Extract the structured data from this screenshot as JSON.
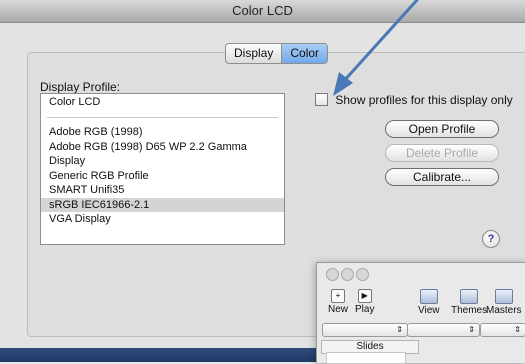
{
  "window": {
    "title": "Color LCD"
  },
  "tabs": [
    {
      "label": "Display"
    },
    {
      "label": "Color"
    }
  ],
  "color_pane": {
    "profile_label": "Display Profile:",
    "profiles": [
      "Color LCD",
      "Adobe RGB (1998)",
      "Adobe RGB (1998) D65 WP 2.2 Gamma",
      "Display",
      "Generic RGB Profile",
      "SMART Unifi35",
      "sRGB IEC61966-2.1",
      "VGA Display"
    ],
    "selected_profile": "sRGB IEC61966-2.1",
    "show_profiles_checkbox": {
      "label": "Show profiles for this display only",
      "checked": false
    },
    "buttons": {
      "open": "Open Profile",
      "delete": "Delete Profile",
      "calibrate": "Calibrate..."
    },
    "help": "?"
  },
  "annotation": {
    "arrow_color": "#4a78b6"
  },
  "keynote": {
    "toolbar": {
      "new": "New",
      "play": "Play",
      "view": "View",
      "themes": "Themes",
      "masters": "Masters"
    },
    "slides_tab": "Slides",
    "icons": [
      "plus-icon",
      "play-icon",
      "view-icon",
      "themes-icon",
      "masters-icon"
    ]
  }
}
